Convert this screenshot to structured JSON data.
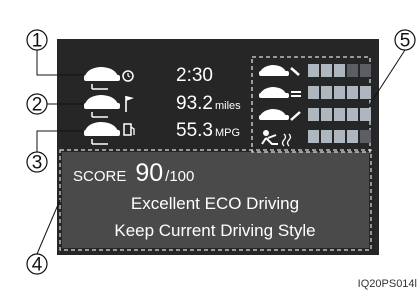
{
  "callouts": [
    "1",
    "2",
    "3",
    "4",
    "5"
  ],
  "trip": {
    "time": "2:30",
    "distance_value": "93.2",
    "distance_unit": "miles",
    "economy_value": "55.3",
    "economy_unit": "MPG"
  },
  "score": {
    "label": "SCORE",
    "value": "90",
    "max": "/100",
    "message_line1": "Excellent ECO Driving",
    "message_line2": "Keep Current Driving Style"
  },
  "eco_evaluation": [
    {
      "icon": "car-start-icon",
      "level": 3,
      "max": 5
    },
    {
      "icon": "car-cruise-icon",
      "level": 5,
      "max": 5
    },
    {
      "icon": "car-stop-icon",
      "level": 5,
      "max": 5
    },
    {
      "icon": "air-conditioner-icon",
      "level": 4,
      "max": 5
    }
  ],
  "colors": {
    "screen_bg": "#262626",
    "panel_bg": "#4a4a4a",
    "bar_on": "#aeb6bf",
    "bar_off": "#5b5e62"
  },
  "image_code": "IQ20PS014l"
}
